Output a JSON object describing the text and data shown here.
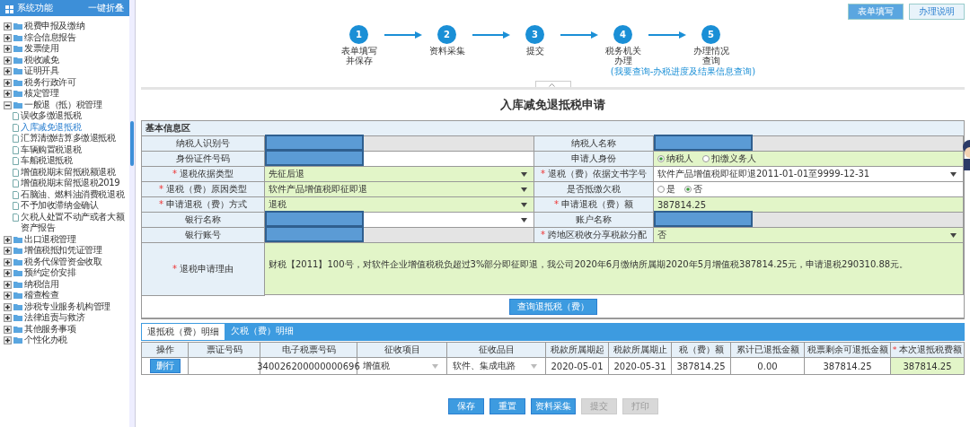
{
  "sidebar": {
    "title": "系统功能",
    "collapse_all": "一键折叠",
    "items": [
      {
        "label": "税费申报及缴纳",
        "expanded": false,
        "selected": false
      },
      {
        "label": "综合信息报告",
        "expanded": false,
        "selected": false
      },
      {
        "label": "发票使用",
        "expanded": false,
        "selected": false
      },
      {
        "label": "税收减免",
        "expanded": false,
        "selected": false
      },
      {
        "label": "证明开具",
        "expanded": false,
        "selected": false
      },
      {
        "label": "税务行政许可",
        "expanded": false,
        "selected": false
      },
      {
        "label": "核定管理",
        "expanded": false,
        "selected": false
      },
      {
        "label": "一般退（抵）税管理",
        "expanded": true,
        "selected": false,
        "children": [
          {
            "label": "误收多缴退抵税",
            "selected": false
          },
          {
            "label": "入库减免退抵税",
            "selected": true
          },
          {
            "label": "汇算清缴结算多缴退抵税",
            "selected": false
          },
          {
            "label": "车辆购置税退税",
            "selected": false
          },
          {
            "label": "车船税退抵税",
            "selected": false
          },
          {
            "label": "增值税期末留抵税额退税",
            "selected": false
          },
          {
            "label": "增值税期末留抵退税2019",
            "selected": false
          },
          {
            "label": "石脑油、燃料油消费税退税",
            "selected": false
          },
          {
            "label": "不予加收滞纳金确认",
            "selected": false
          },
          {
            "label": "欠税人处置不动产或者大额资产报告",
            "selected": false
          }
        ]
      },
      {
        "label": "出口退税管理",
        "expanded": false,
        "selected": false
      },
      {
        "label": "增值税抵扣凭证管理",
        "expanded": false,
        "selected": false
      },
      {
        "label": "税务代保管资金收取",
        "expanded": false,
        "selected": false
      },
      {
        "label": "预约定价安排",
        "expanded": false,
        "selected": false
      },
      {
        "label": "纳税信用",
        "expanded": false,
        "selected": false
      },
      {
        "label": "稽查检查",
        "expanded": false,
        "selected": false
      },
      {
        "label": "涉税专业服务机构管理",
        "expanded": false,
        "selected": false
      },
      {
        "label": "法律追责与救济",
        "expanded": false,
        "selected": false
      },
      {
        "label": "其他服务事项",
        "expanded": false,
        "selected": false
      },
      {
        "label": "个性化办税",
        "expanded": false,
        "selected": false
      }
    ]
  },
  "top_tabs": [
    {
      "label": "表单填写",
      "selected": true
    },
    {
      "label": "办理说明",
      "selected": false
    }
  ],
  "steps": [
    {
      "number": "1",
      "label": "表单填写并保存"
    },
    {
      "number": "2",
      "label": "资料采集"
    },
    {
      "number": "3",
      "label": "提交"
    },
    {
      "number": "4",
      "label": "税务机关办理"
    },
    {
      "number": "5",
      "label": "办理情况查询"
    }
  ],
  "progress_link": "(我要查询-办税进度及结果信息查询)",
  "form": {
    "title": "入库减免退抵税申请",
    "section": "基本信息区",
    "fields": [
      {
        "label": "纳税人识别号",
        "kind": "text",
        "readonly": true,
        "highlighted": false,
        "redacted": true
      },
      {
        "label": "纳税人名称",
        "kind": "text",
        "readonly": true,
        "highlighted": false,
        "redacted": true
      },
      {
        "label": "身份证件号码",
        "kind": "text",
        "readonly": false,
        "highlighted": false,
        "redacted": true
      },
      {
        "label": "申请人身份",
        "kind": "radio",
        "readonly": false,
        "highlighted": true,
        "options": [
          {
            "label": "纳税人",
            "selected": true
          },
          {
            "label": "扣缴义务人",
            "selected": false
          }
        ]
      },
      {
        "marker": "*",
        "label": "退税依据类型",
        "kind": "select",
        "readonly": false,
        "highlighted": true,
        "value": "先征后退"
      },
      {
        "marker": "*",
        "label": "退税（费）依据文书字号",
        "kind": "select",
        "readonly": false,
        "highlighted": false,
        "value": "软件产品增值税即征即退2011-01-01至9999-12-31"
      },
      {
        "marker": "*",
        "label": "退税（费）原因类型",
        "kind": "select",
        "readonly": false,
        "highlighted": true,
        "value": "软件产品增值税即征即退"
      },
      {
        "label": "是否抵缴欠税",
        "kind": "radio",
        "readonly": false,
        "highlighted": false,
        "options": [
          {
            "label": "是",
            "selected": false
          },
          {
            "label": "否",
            "selected": true
          }
        ]
      },
      {
        "marker": "*",
        "label": "申请退税（费）方式",
        "kind": "select",
        "readonly": false,
        "highlighted": true,
        "value": "退税"
      },
      {
        "marker": "*",
        "label": "申请退税（费）额",
        "kind": "text",
        "readonly": false,
        "highlighted": true,
        "value": "387814.25"
      },
      {
        "label": "银行名称",
        "kind": "select",
        "readonly": false,
        "highlighted": false,
        "redacted": true
      },
      {
        "label": "账户名称",
        "kind": "text",
        "readonly": true,
        "highlighted": false,
        "redacted": true
      },
      {
        "label": "银行账号",
        "kind": "text",
        "readonly": true,
        "highlighted": false,
        "redacted": true
      },
      {
        "marker": "*",
        "label": "跨地区税收分享税款分配",
        "kind": "select",
        "readonly": false,
        "highlighted": true,
        "value": "否"
      },
      {
        "marker": "*",
        "label": "退税申请理由",
        "kind": "textarea",
        "readonly": false,
        "highlighted": true,
        "value": "财税【2011】100号，对软件企业增值税税负超过3%部分即征即退，我公司2020年6月缴纳所属期2020年5月增值税387814.25元，申请退税290310.88元。"
      }
    ]
  },
  "query_button": "查询退抵税（费）",
  "detail_tabs": [
    {
      "label": "退抵税（费）明细",
      "selected": true
    },
    {
      "label": "欠税（费）明细",
      "selected": false
    }
  ],
  "table": {
    "columns": [
      {
        "label": "操作"
      },
      {
        "label": "票证号码"
      },
      {
        "label": "电子税票号码"
      },
      {
        "label": "征收项目"
      },
      {
        "label": "征收品目"
      },
      {
        "label": "税款所属期起"
      },
      {
        "label": "税款所属期止"
      },
      {
        "label": "税（费）额"
      },
      {
        "label": "累计已退抵金额"
      },
      {
        "label": "税票剩余可退抵金额"
      },
      {
        "marker": "*",
        "label": "本次退抵税费额"
      }
    ],
    "rows": [
      {
        "cells": [
          {
            "kind": "button",
            "value": "删行"
          },
          {
            "kind": "text"
          },
          {
            "kind": "text",
            "value": "340026200000000696"
          },
          {
            "kind": "select",
            "value": "增值税"
          },
          {
            "kind": "select",
            "value": "软件、集成电路"
          },
          {
            "kind": "text",
            "value": "2020-05-01"
          },
          {
            "kind": "text",
            "value": "2020-05-31"
          },
          {
            "kind": "text",
            "value": "387814.25"
          },
          {
            "kind": "text",
            "value": "0.00"
          },
          {
            "kind": "text",
            "value": "387814.25"
          },
          {
            "kind": "input",
            "value": "387814.25"
          }
        ]
      }
    ]
  },
  "buttons": [
    {
      "label": "保存",
      "disabled": false
    },
    {
      "label": "重置",
      "disabled": false
    },
    {
      "label": "资料采集",
      "disabled": false
    },
    {
      "label": "提交",
      "disabled": true
    },
    {
      "label": "打印",
      "disabled": true
    }
  ]
}
